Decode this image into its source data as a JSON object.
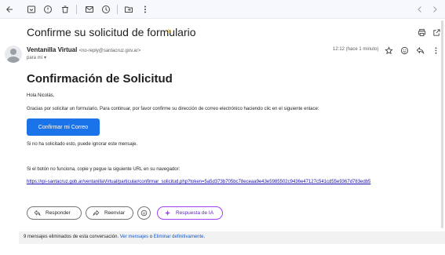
{
  "subject": "Confirme su solicitud de formulario",
  "sender": {
    "name": "Ventanilla Virtual",
    "email": "<no-reply@santacruz.gov.ar>",
    "to": "para mí",
    "time": "12:12 (hace 1 minuto)"
  },
  "body": {
    "heading": "Confirmación de Solicitud",
    "greeting": "Hola Nicolás,",
    "intro": "Gracias por solicitar un formulario. Para continuar, por favor confirme su dirección de correo electrónico haciendo clic en el siguiente enlace:",
    "confirm_button": "Confirmar mi Correo",
    "ignore_note": "Si no ha solicitado esto, puede ignorar este mensaje.",
    "fallback_note": "Si el botón no funciona, copie y pegue la siguiente URL en su navegador:",
    "url": "https://rpi-santacruz.gob.ar/ventanillaVirtual/particular/confirmar_solicitud.php?token=5a5d373b705bc78eceaa9e43e5985502c9436e47127c541cd55e9367d783edb5"
  },
  "actions": {
    "reply": "Responder",
    "forward": "Reenviar",
    "ai": "Respuesta de IA"
  },
  "footer": {
    "text": "9 mensajes eliminados de esta conversación.",
    "view": "Ver mensajes",
    "or": "o",
    "delete": "Eliminar definitivamente",
    "end": "."
  },
  "icons": [
    "back-arrow-icon",
    "archive-icon",
    "report-spam-icon",
    "trash-icon",
    "mark-unread-icon",
    "snooze-icon",
    "move-to-icon",
    "more-icon",
    "chevron-left-icon",
    "chevron-right-icon",
    "print-icon",
    "open-new-window-icon",
    "star-icon",
    "emoji-icon",
    "reply-icon",
    "more-vert-icon"
  ],
  "colors": {
    "primary": "#1a73e8",
    "link": "#1a0dab",
    "ai": "#a142f4",
    "important": "#f9ab00"
  }
}
